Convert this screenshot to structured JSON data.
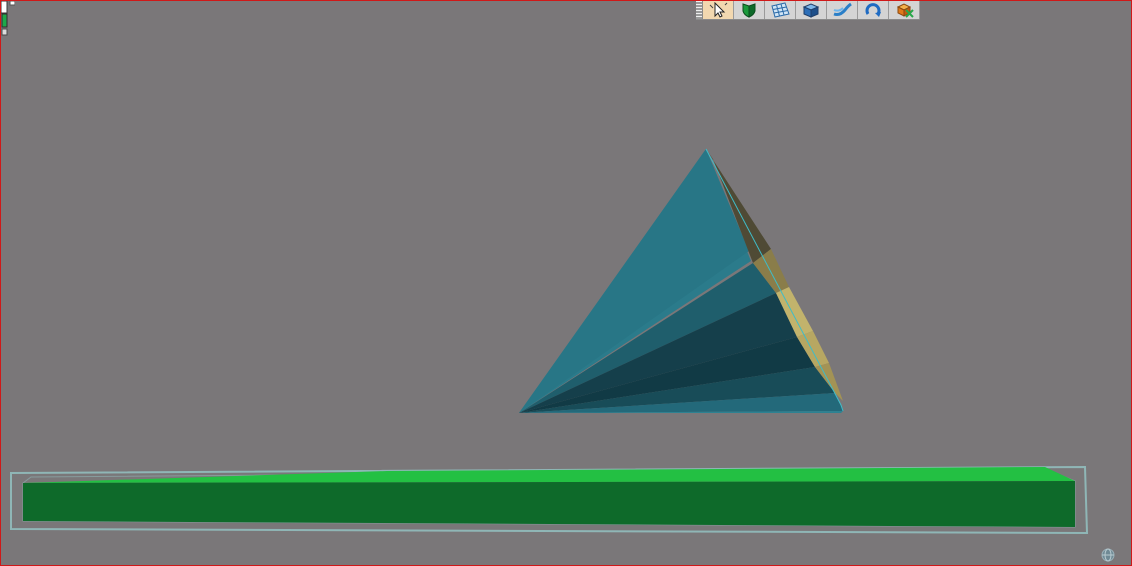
{
  "app": {
    "viewport_background": "#7a7779",
    "frame_color": "#d01818"
  },
  "toolbar": {
    "buttons": [
      {
        "icon": "select-pointer-icon",
        "active": true
      },
      {
        "icon": "shield-surface-icon"
      },
      {
        "icon": "mesh-grid-icon"
      },
      {
        "icon": "solid-box-icon"
      },
      {
        "icon": "sweep-curve-icon"
      },
      {
        "icon": "rotate-arrow-icon"
      },
      {
        "icon": "delete-body-icon"
      }
    ]
  },
  "scene": {
    "objects": [
      {
        "name": "tetrahedron",
        "colors": {
          "face": "#2a7a8a",
          "shadow": "#0f3f4c",
          "rim": "#c8b468"
        }
      },
      {
        "name": "ground-plate",
        "colors": {
          "top": "#23c043",
          "front": "#0e6a2a",
          "outline": "#8fb6b6"
        }
      }
    ]
  }
}
